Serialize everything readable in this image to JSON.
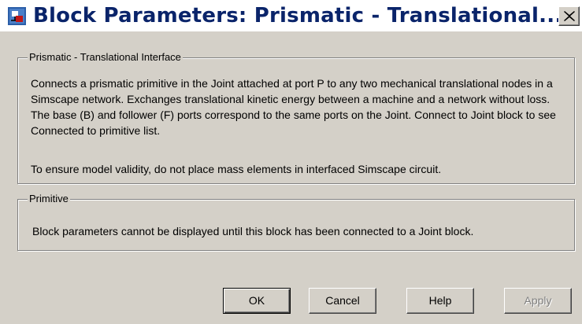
{
  "window": {
    "title": "Block Parameters: Prismatic - Translational..."
  },
  "interface_group": {
    "legend": "Prismatic - Translational Interface",
    "description": "Connects a prismatic primitive in the Joint attached at port P to any two mechanical translational nodes in a Simscape network. Exchanges translational kinetic energy between a machine and a network without loss. The base (B) and follower (F) ports correspond to the same ports on the Joint. Connect to Joint block to see Connected to primitive list.",
    "note": "To ensure model validity, do not place mass elements in interfaced Simscape circuit."
  },
  "primitive_group": {
    "legend": "Primitive",
    "message": "Block parameters cannot be displayed until this block has been connected to a Joint block."
  },
  "buttons": {
    "ok": "OK",
    "cancel": "Cancel",
    "help": "Help",
    "apply": "Apply"
  },
  "colors": {
    "dialog_bg": "#d4d0c8",
    "title_text": "#0a246a",
    "disabled_text": "#808080"
  },
  "icons": {
    "app": "simulink-block-icon",
    "close": "close-icon"
  }
}
